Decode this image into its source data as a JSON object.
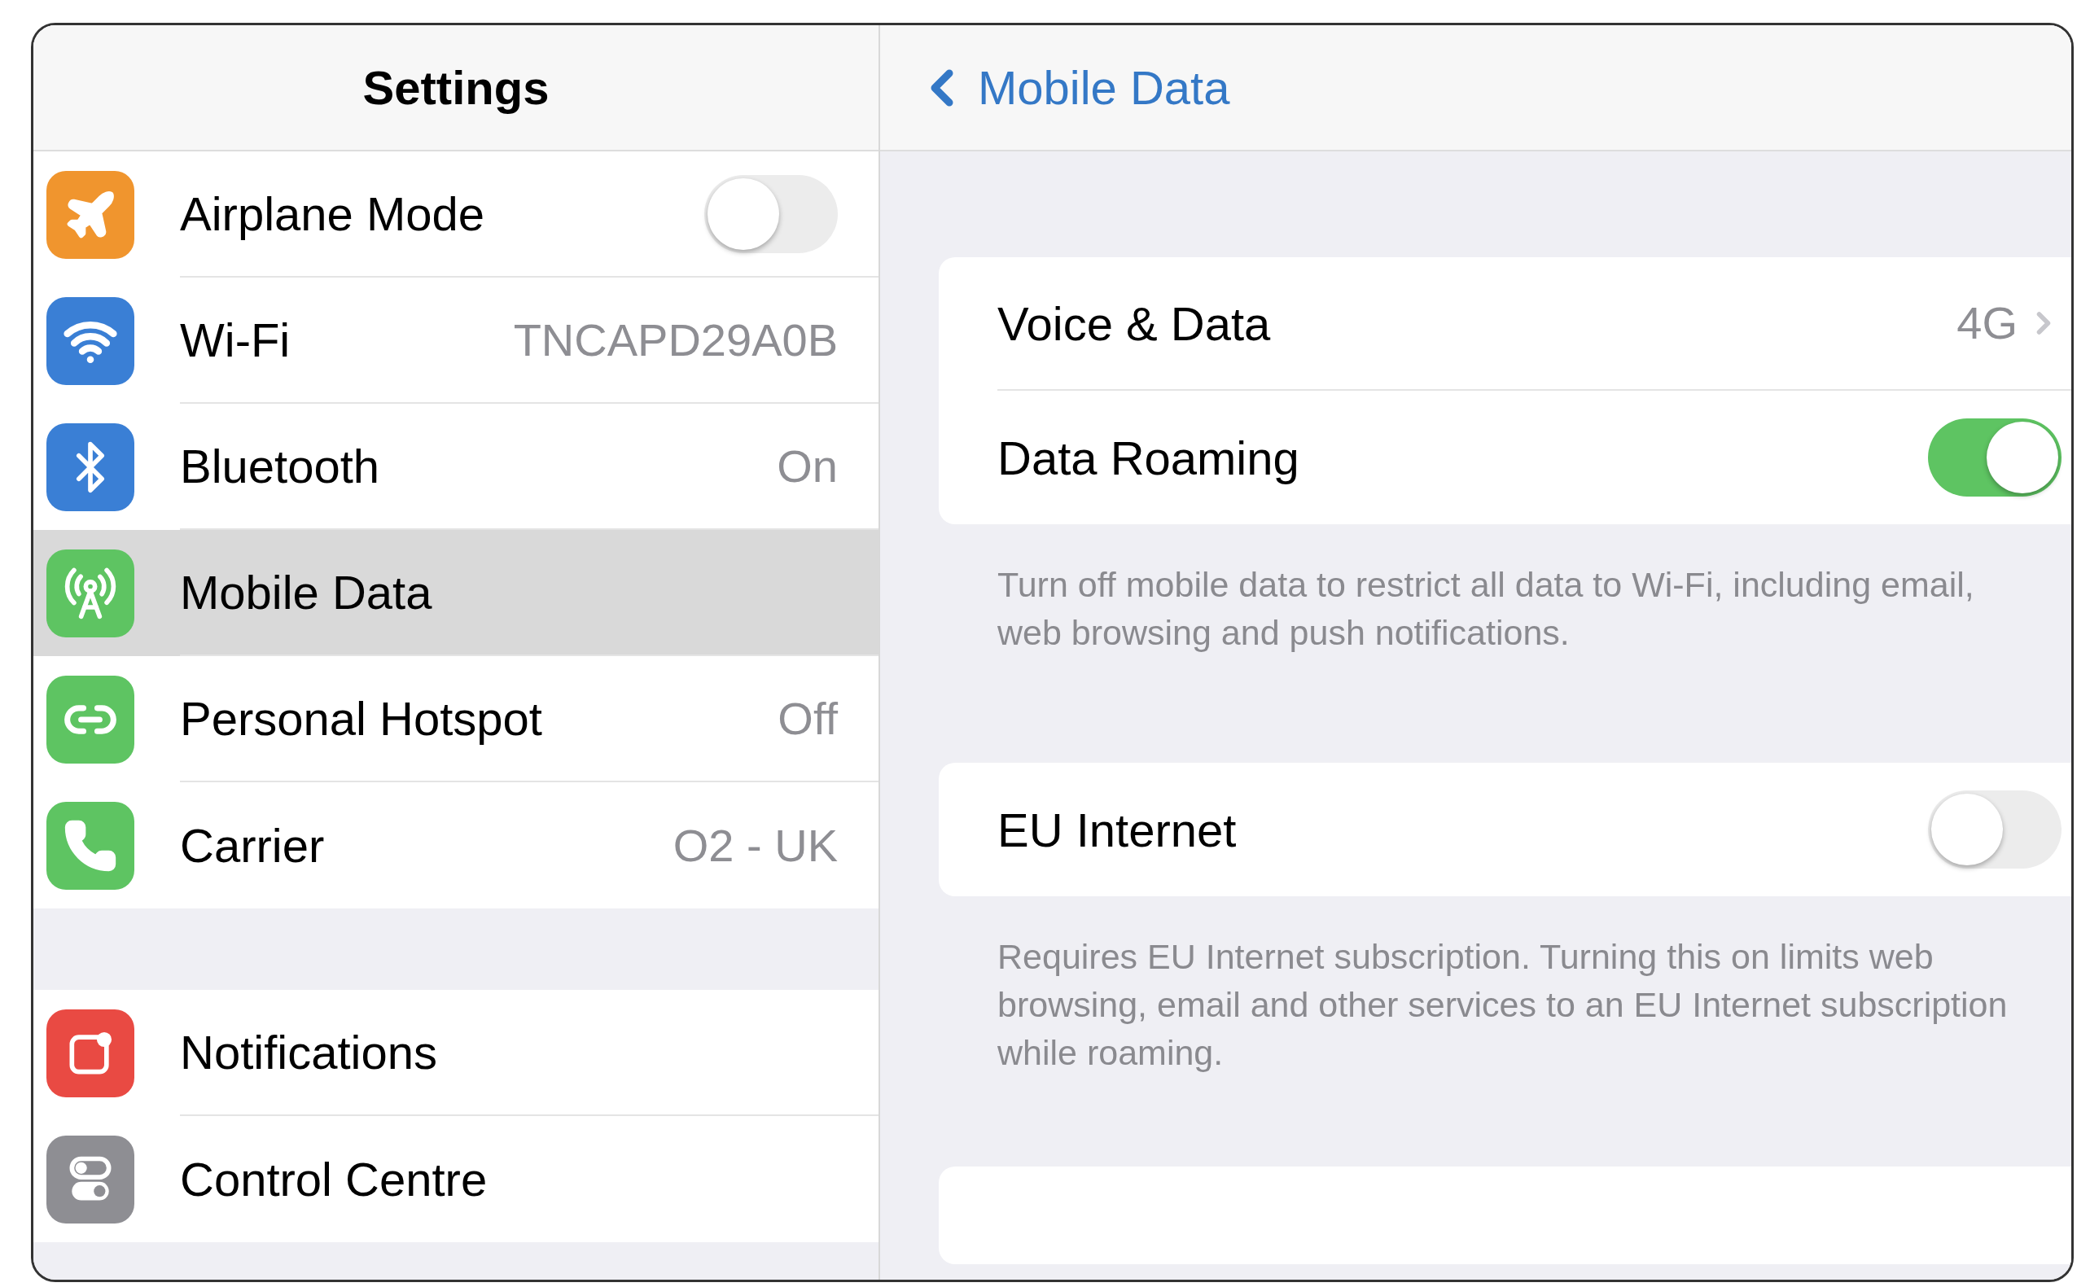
{
  "sidebar": {
    "title": "Settings",
    "groups": [
      {
        "items": [
          {
            "label": "Airplane Mode",
            "color": "#f0952e",
            "kind": "toggle",
            "on": false,
            "selected": false
          },
          {
            "label": "Wi-Fi",
            "color": "#3a7fd5",
            "kind": "value",
            "value": "TNCAPD29A0B",
            "selected": false
          },
          {
            "label": "Bluetooth",
            "color": "#3a7fd5",
            "kind": "value",
            "value": "On",
            "selected": false
          },
          {
            "label": "Mobile Data",
            "color": "#5ec462",
            "kind": "plain",
            "selected": true
          },
          {
            "label": "Personal Hotspot",
            "color": "#5ec462",
            "kind": "value",
            "value": "Off",
            "selected": false
          },
          {
            "label": "Carrier",
            "color": "#5ec462",
            "kind": "value",
            "value": "O2 - UK",
            "selected": false
          }
        ]
      },
      {
        "items": [
          {
            "label": "Notifications",
            "color": "#e94a43",
            "kind": "plain",
            "selected": false
          },
          {
            "label": "Control Centre",
            "color": "#8e8e93",
            "kind": "plain",
            "selected": false
          }
        ]
      }
    ]
  },
  "detail": {
    "back": "Mobile Data",
    "sections": [
      {
        "rows": [
          {
            "label": "Voice & Data",
            "kind": "value",
            "value": "4G"
          },
          {
            "label": "Data Roaming",
            "kind": "toggle",
            "on": true
          }
        ],
        "footer": "Turn off mobile data to restrict all data to Wi-Fi, including email, web browsing and push notifications."
      },
      {
        "rows": [
          {
            "label": "EU Internet",
            "kind": "toggle",
            "on": false
          }
        ],
        "footer": "Requires EU Internet subscription. Turning this on limits web browsing, email and other services to an EU Internet subscription while roaming."
      }
    ]
  }
}
